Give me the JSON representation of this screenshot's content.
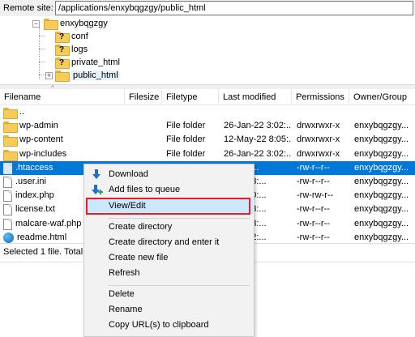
{
  "remote": {
    "label": "Remote site:",
    "path": "/applications/enxybqgzgy/public_html"
  },
  "tree": {
    "root": "enxybqgzgy",
    "children": [
      {
        "label": "conf",
        "unknown": true
      },
      {
        "label": "logs",
        "unknown": true
      },
      {
        "label": "private_html",
        "unknown": true
      },
      {
        "label": "public_html",
        "unknown": false,
        "selected": true
      }
    ]
  },
  "columns": {
    "filename": "Filename",
    "filesize": "Filesize",
    "filetype": "Filetype",
    "modified": "Last modified",
    "permissions": "Permissions",
    "owner": "Owner/Group"
  },
  "files": [
    {
      "name": "..",
      "icon": "folder-icon",
      "size": "",
      "type": "",
      "modified": "",
      "perms": "",
      "owner": ""
    },
    {
      "name": "wp-admin",
      "icon": "folder-icon",
      "size": "",
      "type": "File folder",
      "modified": "26-Jan-22 3:02:...",
      "perms": "drwxrwxr-x",
      "owner": "enxybqgzgy..."
    },
    {
      "name": "wp-content",
      "icon": "folder-icon",
      "size": "",
      "type": "File folder",
      "modified": "12-May-22 8:05:...",
      "perms": "drwxrwxr-x",
      "owner": "enxybqgzgy..."
    },
    {
      "name": "wp-includes",
      "icon": "folder-icon",
      "size": "",
      "type": "File folder",
      "modified": "26-Jan-22 3:02:...",
      "perms": "drwxrwxr-x",
      "owner": "enxybqgzgy..."
    },
    {
      "name": ".htaccess",
      "icon": "file-icon",
      "size": "",
      "type": "",
      "modified": "-22 5:1...",
      "perms": "-rw-r--r--",
      "owner": "enxybqgzgy...",
      "selected": true
    },
    {
      "name": ".user.ini",
      "icon": "file-icon",
      "size": "",
      "type": "",
      "modified": "-22 6:03:...",
      "perms": "-rw-r--r--",
      "owner": "enxybqgzgy..."
    },
    {
      "name": "index.php",
      "icon": "file-icon",
      "size": "",
      "type": "",
      "modified": "-21 2:20:...",
      "perms": "-rw-rw-r--",
      "owner": "enxybqgzgy..."
    },
    {
      "name": "license.txt",
      "icon": "file-icon",
      "size": "",
      "type": "",
      "modified": "-22 6:03:...",
      "perms": "-rw-r--r--",
      "owner": "enxybqgzgy..."
    },
    {
      "name": "malcare-waf.php",
      "icon": "file-icon",
      "size": "",
      "type": "",
      "modified": "-22 6:03:...",
      "perms": "-rw-r--r--",
      "owner": "enxybqgzgy..."
    },
    {
      "name": "readme.html",
      "icon": "globe-icon",
      "size": "",
      "type": "",
      "modified": "-22 2:02:...",
      "perms": "-rw-r--r--",
      "owner": "enxybqgzgy..."
    }
  ],
  "status": "Selected 1 file. Total si",
  "context_menu": {
    "download": "Download",
    "add_to_queue": "Add files to queue",
    "view_edit": "View/Edit",
    "create_dir": "Create directory",
    "create_dir_enter": "Create directory and enter it",
    "create_file": "Create new file",
    "refresh": "Refresh",
    "delete": "Delete",
    "rename": "Rename",
    "copy_url": "Copy URL(s) to clipboard"
  },
  "colors": {
    "selection": "#0078d7",
    "highlight_box": "#e0212a",
    "folder": "#f7cb58"
  }
}
